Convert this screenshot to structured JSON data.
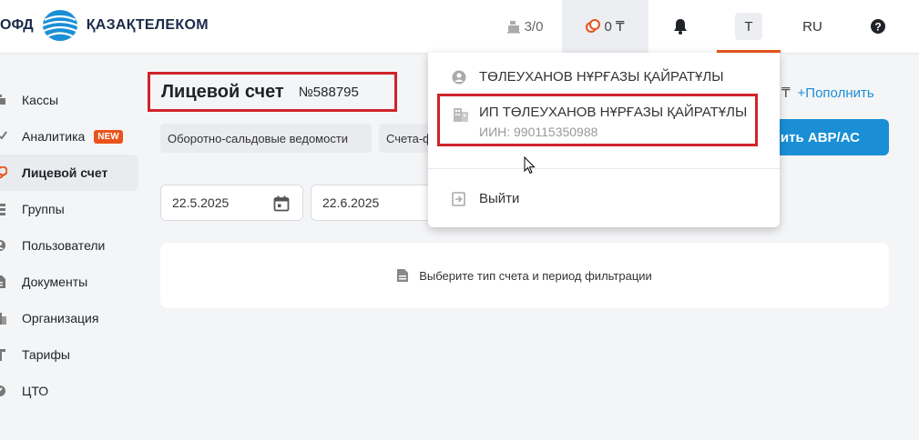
{
  "header": {
    "logo_ofd": "ОФД",
    "logo_brand": "ҚАЗАҚТЕЛЕКОМ",
    "kassa_count": "3/0",
    "balance": "0 ₸",
    "user_initial": "Т",
    "language": "RU",
    "icons": {
      "kassa": "cash-register-icon",
      "balance": "coins-icon",
      "bell": "bell-icon",
      "help": "help-icon"
    }
  },
  "sidebar": {
    "items": [
      {
        "label": "Кассы",
        "icon": "cash-register-icon"
      },
      {
        "label": "Аналитика",
        "icon": "chart-icon",
        "badge": "NEW"
      },
      {
        "label": "Лицевой счет",
        "icon": "coins-icon",
        "active": true
      },
      {
        "label": "Группы",
        "icon": "groups-icon"
      },
      {
        "label": "Пользователи",
        "icon": "user-icon"
      },
      {
        "label": "Документы",
        "icon": "document-icon"
      },
      {
        "label": "Организация",
        "icon": "building-icon"
      },
      {
        "label": "Тарифы",
        "icon": "tariff-icon"
      },
      {
        "label": "ЦТО",
        "icon": "service-icon"
      }
    ]
  },
  "main": {
    "title": "Лицевой счет",
    "account_number": "№588795",
    "tabs": [
      "Оборотно-сальдовые ведомости",
      "Счета-ф"
    ],
    "date_from": "22.5.2025",
    "date_to": "22.6.2025",
    "empty_message": "Выберите тип счета и период фильтрации",
    "topup_symbol": "₸",
    "topup_label": "+Пополнить",
    "avr_button": "ить АВР/АС"
  },
  "dropdown": {
    "user_name": "ТӨЛЕУХАНОВ НҰРҒАЗЫ ҚАЙРАТҰЛЫ",
    "org_name": "ИП ТӨЛЕУХАНОВ НҰРҒАЗЫ ҚАЙРАТҰЛЫ",
    "org_iin": "ИИН: 990115350988",
    "logout": "Выйти"
  },
  "colors": {
    "accent_orange": "#e8541c",
    "primary_blue": "#1a8fd6",
    "highlight_red": "#d0232a",
    "brand_navy": "#1b2a4a"
  }
}
